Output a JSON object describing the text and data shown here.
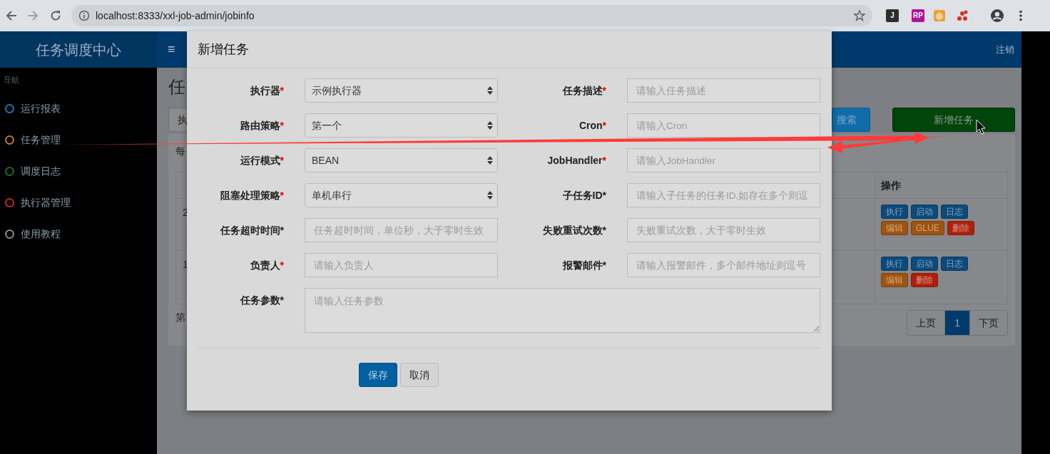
{
  "browser": {
    "url": "localhost:8333/xxl-job-admin/jobinfo",
    "extension_labels": [
      "J",
      "RP"
    ]
  },
  "header": {
    "logo": "任务调度中心",
    "menu_toggle": "≡",
    "logout": "注销"
  },
  "sidebar": {
    "heading": "导航",
    "items": [
      {
        "label": "运行报表",
        "color": "#1f78b4"
      },
      {
        "label": "任务管理",
        "color": "#c0762a"
      },
      {
        "label": "调度日志",
        "color": "#1e6b2a"
      },
      {
        "label": "执行器管理",
        "color": "#b3301f"
      },
      {
        "label": "使用教程",
        "color": "#8c8c8c"
      }
    ]
  },
  "page": {
    "title": "任",
    "filter_button": "执",
    "search_button": "搜索",
    "add_button": "新增任务",
    "panel_text": "每",
    "table": {
      "action_heading": "操作",
      "rows": [
        {
          "column_1": "2",
          "actions": [
            {
              "label": "执行",
              "kind": "primary"
            },
            {
              "label": "启动",
              "kind": "primary"
            },
            {
              "label": "日志",
              "kind": "primary"
            },
            {
              "label": "编辑",
              "kind": "warning"
            },
            {
              "label": "GLUE",
              "kind": "warning"
            },
            {
              "label": "删除",
              "kind": "danger"
            }
          ]
        },
        {
          "column_1": "1",
          "actions": [
            {
              "label": "执行",
              "kind": "primary"
            },
            {
              "label": "启动",
              "kind": "primary"
            },
            {
              "label": "日志",
              "kind": "primary"
            },
            {
              "label": "编辑",
              "kind": "warning"
            },
            {
              "label": "删除",
              "kind": "danger"
            }
          ]
        }
      ]
    },
    "pagination_info": "第",
    "pagination": [
      {
        "label": "上页",
        "selected": false
      },
      {
        "label": "1",
        "selected": true
      },
      {
        "label": "下页",
        "selected": false
      }
    ]
  },
  "modal": {
    "title": "新增任务",
    "fields": [
      {
        "label": "执行器",
        "mark": "*",
        "mark_red": true,
        "kind": "select",
        "value": "示例执行器"
      },
      {
        "label": "任务描述",
        "mark": "*",
        "mark_red": true,
        "kind": "input",
        "placeholder": "请输入任务描述"
      },
      {
        "label": "路由策略",
        "mark": "*",
        "mark_red": true,
        "kind": "select",
        "value": "第一个"
      },
      {
        "label": "Cron",
        "mark": "*",
        "mark_red": true,
        "kind": "input",
        "placeholder": "请输入Cron"
      },
      {
        "label": "运行模式",
        "mark": "*",
        "mark_red": true,
        "kind": "select",
        "value": "BEAN"
      },
      {
        "label": "JobHandler",
        "mark": "*",
        "mark_red": true,
        "kind": "input",
        "placeholder": "请输入JobHandler"
      },
      {
        "label": "阻塞处理策略",
        "mark": "*",
        "mark_red": true,
        "kind": "select",
        "value": "单机串行"
      },
      {
        "label": "子任务ID",
        "mark": "*",
        "mark_red": false,
        "kind": "input",
        "placeholder": "请输入子任务的任务ID,如存在多个则逗"
      },
      {
        "label": "任务超时时间",
        "mark": "*",
        "mark_red": false,
        "kind": "input",
        "placeholder": "任务超时时间，单位秒，大于零时生效"
      },
      {
        "label": "失败重试次数",
        "mark": "*",
        "mark_red": false,
        "kind": "input",
        "placeholder": "失败重试次数，大于零时生效"
      },
      {
        "label": "负责人",
        "mark": "*",
        "mark_red": true,
        "kind": "input",
        "placeholder": "请输入负责人"
      },
      {
        "label": "报警邮件",
        "mark": "*",
        "mark_red": false,
        "kind": "input",
        "placeholder": "请输入报警邮件，多个邮件地址则逗号"
      },
      {
        "label": "任务参数",
        "mark": "*",
        "mark_red": false,
        "kind": "textarea",
        "placeholder": "请输入任务参数"
      }
    ],
    "buttons": [
      {
        "label": "保存",
        "kind": "primary"
      },
      {
        "label": "取消",
        "kind": "secondary"
      }
    ]
  }
}
